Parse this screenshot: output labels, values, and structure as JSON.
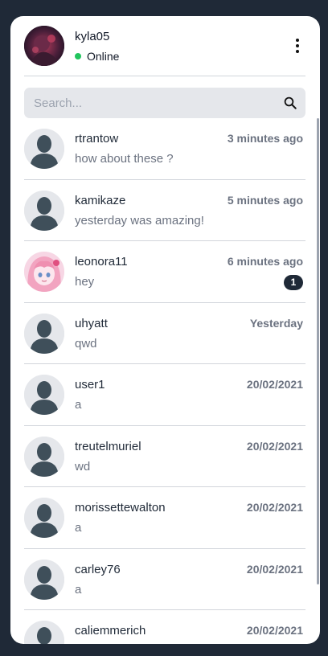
{
  "user": {
    "name": "kyla05",
    "status": "Online"
  },
  "search": {
    "placeholder": "Search..."
  },
  "conversations": [
    {
      "name": "rtrantow",
      "message": "how about these ?",
      "time": "3 minutes ago",
      "avatar": "default-avatar-icon"
    },
    {
      "name": "kamikaze",
      "message": "yesterday was amazing!",
      "time": "5 minutes ago",
      "avatar": "default-avatar-icon"
    },
    {
      "name": "leonora11",
      "message": "hey",
      "time": "6 minutes ago",
      "unread": "1",
      "avatar": "anime-avatar"
    },
    {
      "name": "uhyatt",
      "message": "qwd",
      "time": "Yesterday",
      "avatar": "default-avatar-icon"
    },
    {
      "name": "user1",
      "message": "a",
      "time": "20/02/2021",
      "avatar": "default-avatar-icon"
    },
    {
      "name": "treutelmuriel",
      "message": "wd",
      "time": "20/02/2021",
      "avatar": "default-avatar-icon"
    },
    {
      "name": "morissettewalton",
      "message": "a",
      "time": "20/02/2021",
      "avatar": "default-avatar-icon"
    },
    {
      "name": "carley76",
      "message": "a",
      "time": "20/02/2021",
      "avatar": "default-avatar-icon"
    },
    {
      "name": "caliemmerich",
      "message": "",
      "time": "20/02/2021",
      "avatar": "default-avatar-icon"
    }
  ],
  "colors": {
    "background": "#1f2937",
    "online": "#22c55e",
    "badge": "#1f2937",
    "avatar_silhouette": "#3f4f5a"
  }
}
